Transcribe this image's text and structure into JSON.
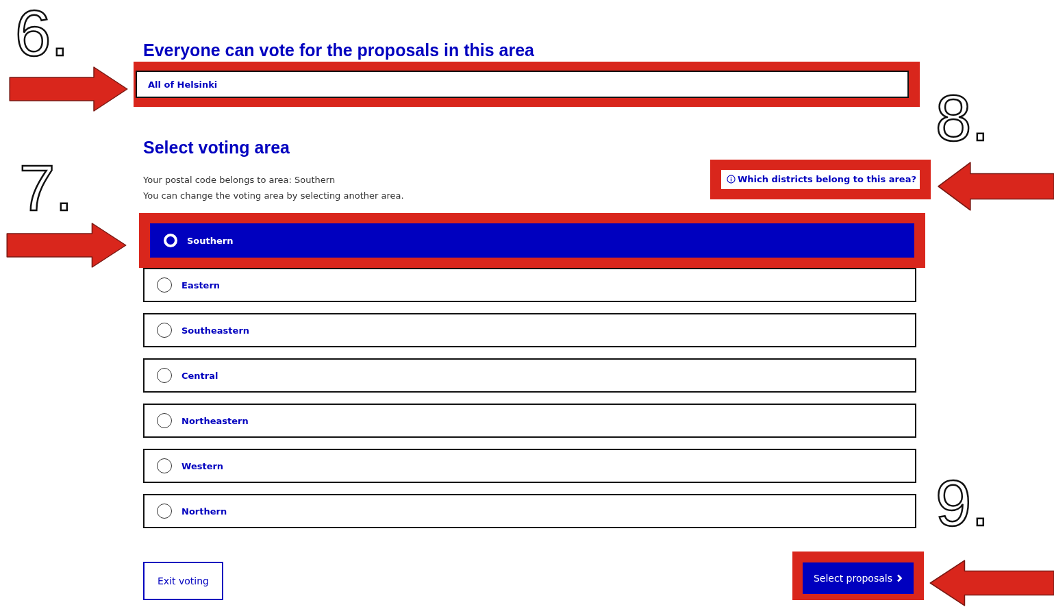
{
  "area_section": {
    "heading": "Everyone can vote for the proposals in this area",
    "field": {
      "value": "All of Helsinki",
      "highlighted": true
    }
  },
  "voting_area": {
    "heading": "Select voting area",
    "info_lines": [
      "Your postal code belongs to area: Southern",
      "You can change the voting area by selecting another area."
    ],
    "help_link": {
      "label": "Which districts belong to this area?",
      "highlighted": true
    },
    "options": [
      {
        "label": "Southern",
        "selected": true,
        "highlighted": true
      },
      {
        "label": "Eastern",
        "selected": false,
        "highlighted": false
      },
      {
        "label": "Southeastern",
        "selected": false,
        "highlighted": false
      },
      {
        "label": "Central",
        "selected": false,
        "highlighted": false
      },
      {
        "label": "Northeastern",
        "selected": false,
        "highlighted": false
      },
      {
        "label": "Western",
        "selected": false,
        "highlighted": false
      },
      {
        "label": "Northern",
        "selected": false,
        "highlighted": false
      }
    ]
  },
  "buttons": [
    {
      "label": "Exit voting",
      "kind": "secondary",
      "highlighted": false
    },
    {
      "label": "Select proposals",
      "kind": "primary",
      "highlighted": true
    }
  ],
  "annotations": [
    {
      "label": "6.",
      "kind": "right"
    },
    {
      "label": "7.",
      "kind": "right"
    },
    {
      "label": "8.",
      "kind": "left"
    },
    {
      "label": "9.",
      "kind": "left"
    }
  ]
}
